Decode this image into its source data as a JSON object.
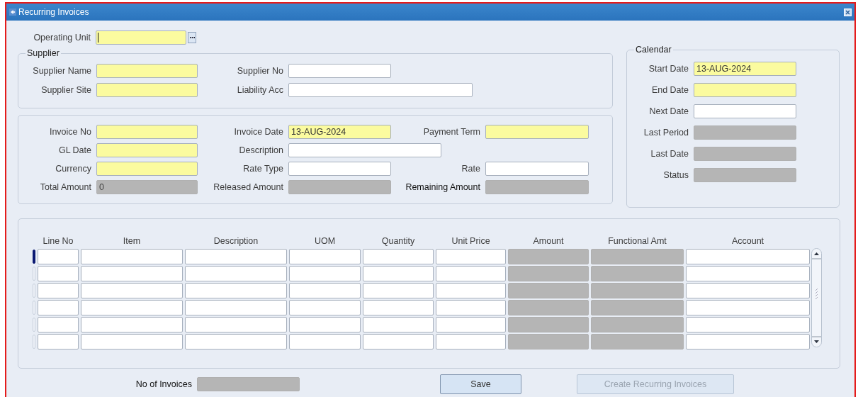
{
  "window": {
    "title": "Recurring Invoices"
  },
  "operating_unit": {
    "label": "Operating Unit",
    "kind": "required",
    "focused": true
  },
  "supplier": {
    "title": "Supplier",
    "fields": [
      {
        "label": "Supplier Name",
        "kind": "required"
      },
      {
        "label": "Supplier No",
        "kind": "optional"
      },
      {
        "label": "Supplier Site",
        "kind": "required"
      },
      {
        "label": "Liability Acc",
        "kind": "optional"
      }
    ]
  },
  "invoice": {
    "fields": [
      {
        "label": "Invoice No",
        "kind": "required"
      },
      {
        "label": "Invoice Date",
        "kind": "required",
        "value": "13-AUG-2024"
      },
      {
        "label": "Payment Term",
        "kind": "required"
      },
      {
        "label": "GL Date",
        "kind": "required"
      },
      {
        "label": "Description",
        "kind": "optional"
      },
      {
        "label": "Currency",
        "kind": "required"
      },
      {
        "label": "Rate Type",
        "kind": "optional"
      },
      {
        "label": "Rate",
        "kind": "optional"
      },
      {
        "label": "Total Amount",
        "kind": "readonly",
        "value": "0"
      },
      {
        "label": "Released Amount",
        "kind": "readonly"
      },
      {
        "label": "Remaining Amount",
        "kind": "readonly"
      }
    ]
  },
  "calendar": {
    "title": "Calendar",
    "fields": [
      {
        "label": "Start Date",
        "kind": "required",
        "value": "13-AUG-2024"
      },
      {
        "label": "End Date",
        "kind": "required"
      },
      {
        "label": "Next Date",
        "kind": "optional"
      },
      {
        "label": "Last Period",
        "kind": "readonly"
      },
      {
        "label": "Last Date",
        "kind": "readonly"
      },
      {
        "label": "Status",
        "kind": "readonly"
      }
    ]
  },
  "lines": {
    "columns": [
      {
        "label": "Line No",
        "kind": "optional"
      },
      {
        "label": "Item",
        "kind": "optional"
      },
      {
        "label": "Description",
        "kind": "optional"
      },
      {
        "label": "UOM",
        "kind": "optional"
      },
      {
        "label": "Quantity",
        "kind": "optional"
      },
      {
        "label": "Unit Price",
        "kind": "optional"
      },
      {
        "label": "Amount",
        "kind": "readonly"
      },
      {
        "label": "Functional Amt",
        "kind": "readonly"
      },
      {
        "label": "Account",
        "kind": "optional"
      }
    ],
    "rows": [
      {
        "selected": true
      },
      {
        "selected": false
      },
      {
        "selected": false
      },
      {
        "selected": false
      },
      {
        "selected": false
      },
      {
        "selected": false
      }
    ]
  },
  "no_of_invoices": {
    "label": "No of Invoices",
    "kind": "readonly"
  },
  "buttons": [
    {
      "label": "Save",
      "disabled": false
    },
    {
      "label": "Create Recurring Invoices",
      "disabled": true
    }
  ]
}
